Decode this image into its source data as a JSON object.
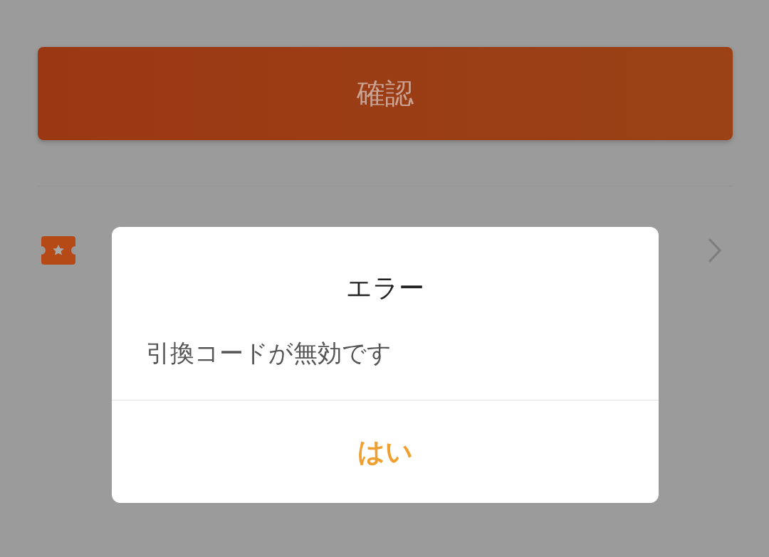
{
  "confirm_button": {
    "label": "確認"
  },
  "dialog": {
    "title": "エラー",
    "message": "引換コードが無効です",
    "buttons": [
      {
        "label": "はい"
      }
    ]
  }
}
